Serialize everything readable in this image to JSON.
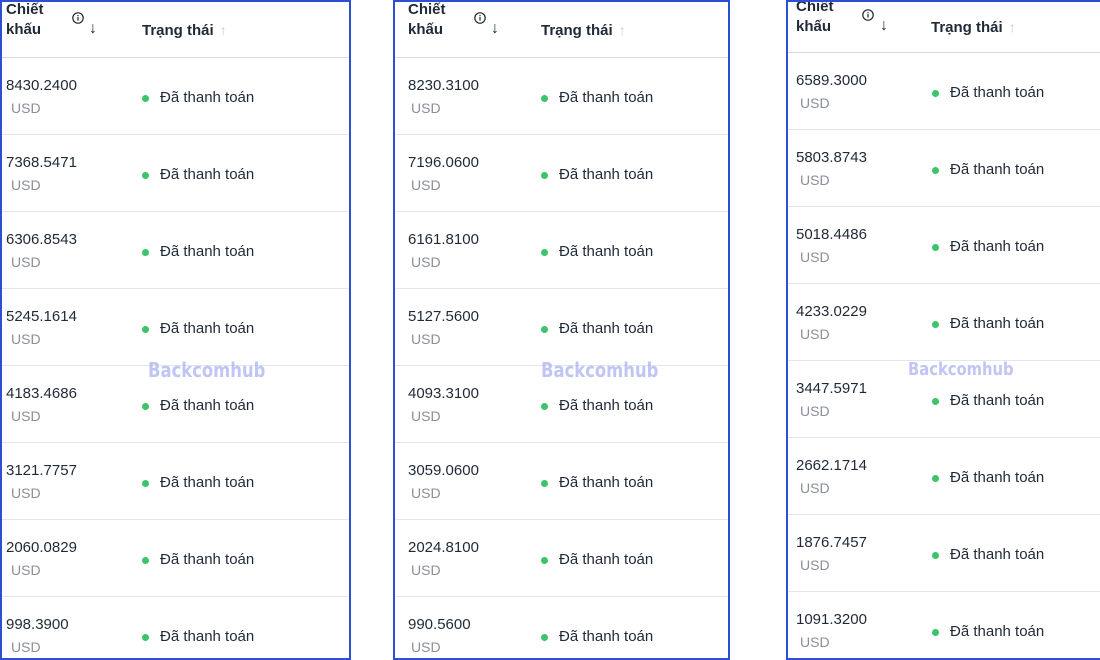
{
  "header": {
    "discount_line1": "Chiết",
    "discount_line2": "khấu",
    "sort_arrow": "↓",
    "status_label": "Trạng thái",
    "status_sort_arrow": "↑"
  },
  "status_text": "Đã thanh toán",
  "watermark": "Backcomhub",
  "colors": {
    "border": "#2d4fd6",
    "status_dot": "#3cc46a",
    "watermark": "#8c96eb"
  },
  "panels": [
    {
      "rows": [
        {
          "amount": "8430.2400",
          "currency": "USD"
        },
        {
          "amount": "7368.5471",
          "currency": "USD"
        },
        {
          "amount": "6306.8543",
          "currency": "USD"
        },
        {
          "amount": "5245.1614",
          "currency": "USD"
        },
        {
          "amount": "4183.4686",
          "currency": "USD"
        },
        {
          "amount": "3121.7757",
          "currency": "USD"
        },
        {
          "amount": "2060.0829",
          "currency": "USD"
        },
        {
          "amount": "998.3900",
          "currency": "USD"
        }
      ]
    },
    {
      "rows": [
        {
          "amount": "8230.3100",
          "currency": "USD"
        },
        {
          "amount": "7196.0600",
          "currency": "USD"
        },
        {
          "amount": "6161.8100",
          "currency": "USD"
        },
        {
          "amount": "5127.5600",
          "currency": "USD"
        },
        {
          "amount": "4093.3100",
          "currency": "USD"
        },
        {
          "amount": "3059.0600",
          "currency": "USD"
        },
        {
          "amount": "2024.8100",
          "currency": "USD"
        },
        {
          "amount": "990.5600",
          "currency": "USD"
        }
      ]
    },
    {
      "rows": [
        {
          "amount": "6589.3000",
          "currency": "USD"
        },
        {
          "amount": "5803.8743",
          "currency": "USD"
        },
        {
          "amount": "5018.4486",
          "currency": "USD"
        },
        {
          "amount": "4233.0229",
          "currency": "USD"
        },
        {
          "amount": "3447.5971",
          "currency": "USD"
        },
        {
          "amount": "2662.1714",
          "currency": "USD"
        },
        {
          "amount": "1876.7457",
          "currency": "USD"
        },
        {
          "amount": "1091.3200",
          "currency": "USD"
        }
      ]
    }
  ]
}
